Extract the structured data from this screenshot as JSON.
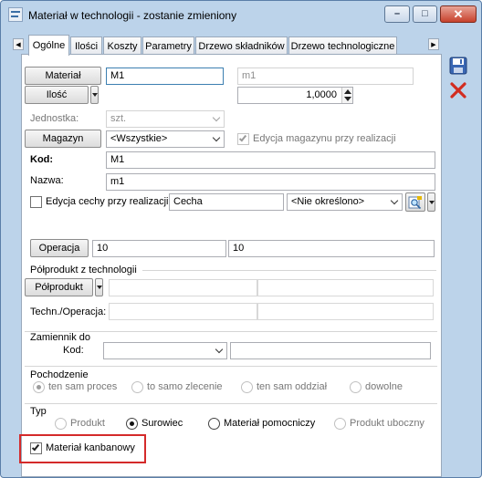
{
  "window": {
    "title": "Materiał w technologii - zostanie zmieniony",
    "minimize_glyph": "–",
    "maximize_glyph": "□",
    "close_glyph": "✕"
  },
  "tabs": [
    {
      "label": "Ogólne",
      "active": true
    },
    {
      "label": "Ilości"
    },
    {
      "label": "Koszty"
    },
    {
      "label": "Parametry"
    },
    {
      "label": "Drzewo składników"
    },
    {
      "label": "Drzewo technologiczne"
    }
  ],
  "tab_nav": {
    "left": "◀",
    "right": "▶"
  },
  "material": {
    "button": "Materiał",
    "code_value": "M1",
    "name_value": "m1"
  },
  "quantity": {
    "button": "Ilość",
    "value": "1,0000"
  },
  "unit": {
    "label": "Jednostka:",
    "value": "szt."
  },
  "warehouse": {
    "button": "Magazyn",
    "value": "<Wszystkie>",
    "checkbox_label": "Edycja magazynu przy realizacji"
  },
  "code": {
    "label": "Kod:",
    "value": "M1"
  },
  "name": {
    "label": "Nazwa:",
    "value": "m1"
  },
  "feature": {
    "checkbox_label": "Edycja cechy przy realizacji",
    "value": "Cecha",
    "option": "<Nie określono>"
  },
  "operation": {
    "button": "Operacja",
    "value1": "10",
    "value2": "10"
  },
  "semi_product": {
    "group_title": "Półprodukt z technologii",
    "button": "Półprodukt",
    "tech_label": "Techn./Operacja:"
  },
  "substitute": {
    "group_title": "Zamiennik do",
    "code_label": "Kod:"
  },
  "origin": {
    "group_title": "Pochodzenie",
    "options": [
      "ten sam proces",
      "to samo zlecenie",
      "ten sam oddział",
      "dowolne"
    ],
    "selected": "ten sam proces"
  },
  "type": {
    "group_title": "Typ",
    "options": [
      "Produkt",
      "Surowiec",
      "Materiał pomocniczy",
      "Produkt uboczny"
    ],
    "selected": "Surowiec"
  },
  "kanban": {
    "label": "Materiał kanbanowy",
    "checked": true
  },
  "colors": {
    "highlight": "#d42a2a",
    "window_frame": "#bcd3ea"
  },
  "icons": [
    "save-icon",
    "cancel-icon",
    "lookup-icon"
  ]
}
